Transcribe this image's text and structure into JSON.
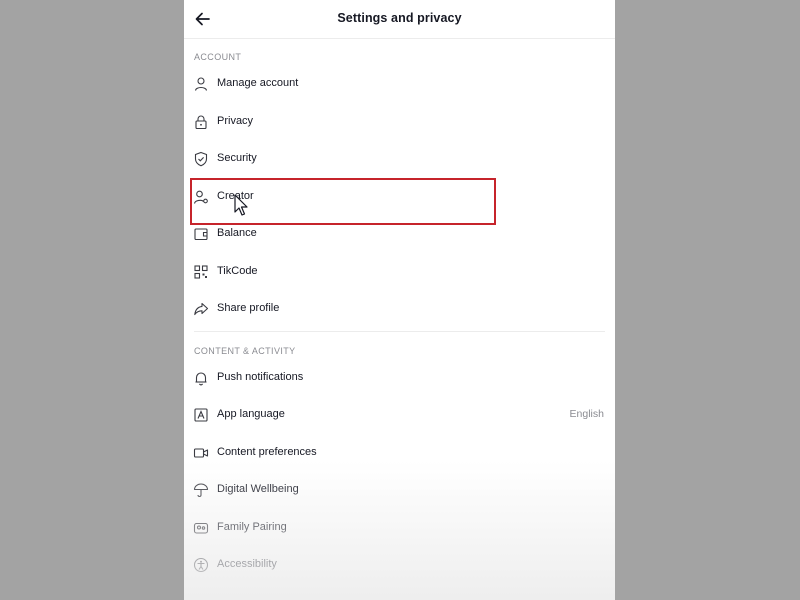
{
  "header": {
    "title": "Settings and privacy"
  },
  "sections": {
    "account": {
      "title": "ACCOUNT",
      "items": {
        "manage_account": "Manage account",
        "privacy": "Privacy",
        "security": "Security",
        "creator": "Creator",
        "balance": "Balance",
        "tikcode": "TikCode",
        "share_profile": "Share profile"
      }
    },
    "content_activity": {
      "title": "CONTENT & ACTIVITY",
      "items": {
        "push_notifications": "Push notifications",
        "app_language": "App language",
        "app_language_value": "English",
        "content_preferences": "Content preferences",
        "digital_wellbeing": "Digital Wellbeing",
        "family_pairing": "Family Pairing",
        "accessibility": "Accessibility"
      }
    }
  },
  "colors": {
    "highlight": "#c6242b",
    "text": "#161823",
    "muted": "#8a8b91",
    "backdrop": "#a3a3a3"
  },
  "icons": [
    "back-arrow-icon",
    "person-icon",
    "lock-icon",
    "shield-icon",
    "creator-icon",
    "wallet-icon",
    "qr-code-icon",
    "share-icon",
    "bell-icon",
    "language-icon",
    "video-icon",
    "umbrella-icon",
    "family-icon",
    "accessibility-icon",
    "cursor-icon"
  ]
}
